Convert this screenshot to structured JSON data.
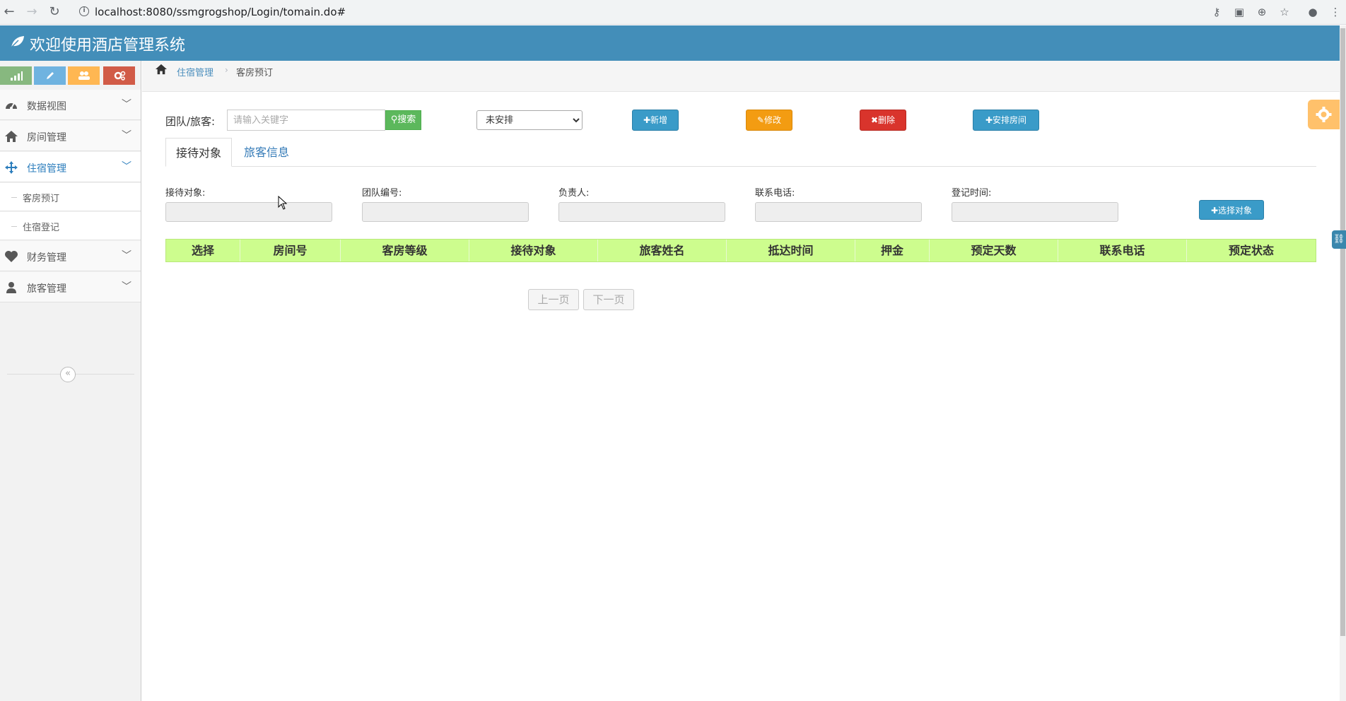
{
  "browser": {
    "url": "localhost:8080/ssmgrogshop/Login/tomain.do#"
  },
  "app": {
    "title": "欢迎使用酒店管理系统"
  },
  "sidebar": {
    "items": [
      {
        "label": "数据视图",
        "icon": "dashboard-icon"
      },
      {
        "label": "房间管理",
        "icon": "home-icon"
      },
      {
        "label": "住宿管理",
        "icon": "move-icon",
        "active": true
      },
      {
        "label": "财务管理",
        "icon": "heart-icon"
      },
      {
        "label": "旅客管理",
        "icon": "user-icon"
      }
    ],
    "subitems": [
      {
        "label": "客房预订"
      },
      {
        "label": "住宿登记"
      }
    ],
    "collapse_glyph": "«"
  },
  "breadcrumb": {
    "parent": "住宿管理",
    "current": "客房预订"
  },
  "toolbar": {
    "label": "团队/旅客:",
    "search_placeholder": "请输入关键字",
    "search_button": "搜索",
    "status_selected": "未安排",
    "add_button": "新增",
    "edit_button": "修改",
    "delete_button": "删除",
    "arrange_button": "安排房间"
  },
  "tabs": [
    {
      "label": "接待对象",
      "active": true
    },
    {
      "label": "旅客信息",
      "active": false
    }
  ],
  "form": {
    "reception_label": "接待对象:",
    "team_no_label": "团队编号:",
    "leader_label": "负责人:",
    "phone_label": "联系电话:",
    "register_time_label": "登记时间:",
    "choose_button": "选择对象"
  },
  "table": {
    "headers": [
      "选择",
      "房间号",
      "客房等级",
      "接待对象",
      "旅客姓名",
      "抵达时间",
      "押金",
      "预定天数",
      "联系电话",
      "预定状态"
    ]
  },
  "pagination": {
    "prev": "上一页",
    "next": "下一页"
  },
  "colors": {
    "header_bg": "#438eb9",
    "table_header_bg": "#cdfd8e",
    "btn_blue": "#3a9bc8",
    "btn_orange": "#f39c12",
    "btn_red": "#d9342c",
    "btn_green": "#5cb85c"
  }
}
